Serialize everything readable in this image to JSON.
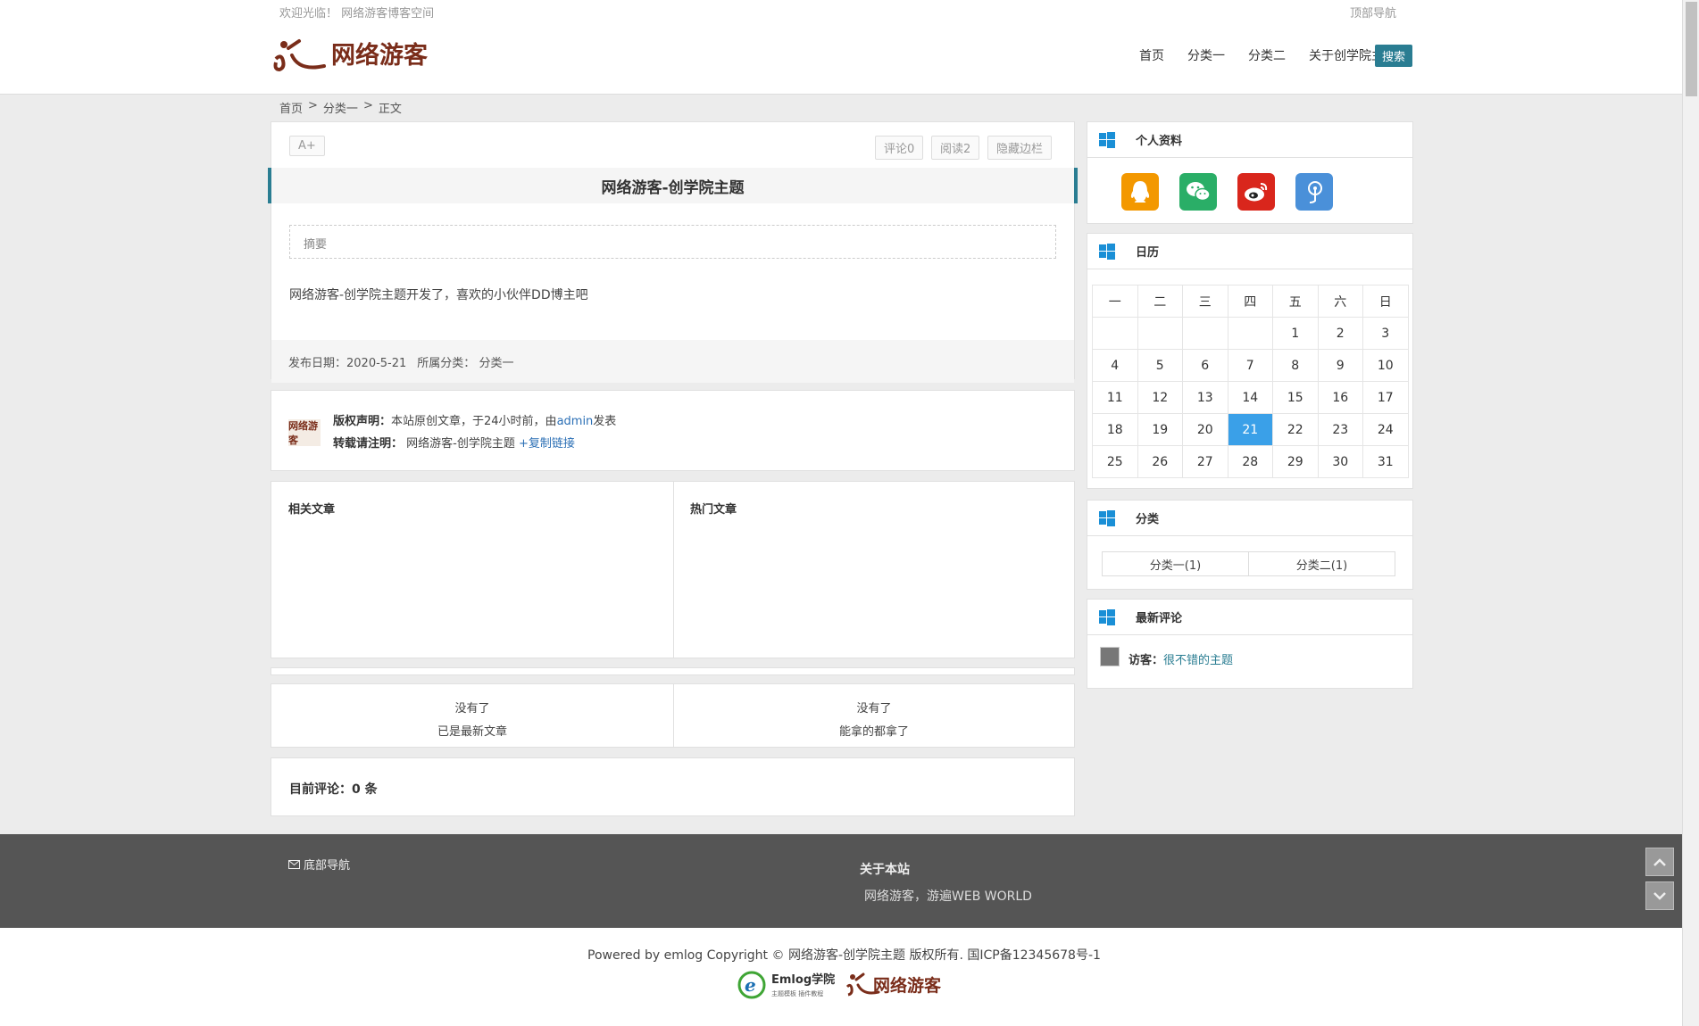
{
  "header": {
    "welcome": "欢迎光临！ 网络游客博客空间",
    "top_nav": "顶部导航",
    "logo_text": "网络游客",
    "nav": [
      "首页",
      "分类一",
      "分类二",
      "关于创学院主题"
    ],
    "search": "搜索"
  },
  "breadcrumb": [
    "首页",
    ">",
    "分类一",
    ">",
    "正文"
  ],
  "article": {
    "font_btn": "A+",
    "comments_btn": "评论0",
    "reads_btn": "阅读2",
    "hide_sidebar_btn": "隐藏边栏",
    "title": "网络游客-创学院主题",
    "summary_label": "摘要",
    "body": "网络游客-创学院主题开发了，喜欢的小伙伴DD博主吧",
    "date_label": "发布日期：2020-5-21",
    "category_label": "所属分类：",
    "category_value": "分类一"
  },
  "copyright": {
    "avatar_text": "网络游客",
    "line1_label": "版权声明：",
    "line1_text_a": "本站原创文章，于24小时前，由",
    "line1_author": "admin",
    "line1_text_b": "发表",
    "line2_label": "转载请注明：",
    "line2_text": "网络游客-创学院主题",
    "line2_link": "+复制链接"
  },
  "related": {
    "left_title": "相关文章",
    "right_title": "热门文章"
  },
  "post_nav": {
    "prev_line1": "没有了",
    "prev_line2": "已是最新文章",
    "next_line1": "没有了",
    "next_line2": "能拿的都拿了"
  },
  "comments": {
    "label": "目前评论：",
    "count": "0",
    "unit": "条"
  },
  "sidebar": {
    "profile_title": "个人资料",
    "calendar_title": "日历",
    "weekdays": [
      "一",
      "二",
      "三",
      "四",
      "五",
      "六",
      "日"
    ],
    "calendar_rows": [
      [
        "",
        "",
        "",
        "",
        "1",
        "2",
        "3"
      ],
      [
        "4",
        "5",
        "6",
        "7",
        "8",
        "9",
        "10"
      ],
      [
        "11",
        "12",
        "13",
        "14",
        "15",
        "16",
        "17"
      ],
      [
        "18",
        "19",
        "20",
        "21",
        "22",
        "23",
        "24"
      ],
      [
        "25",
        "26",
        "27",
        "28",
        "29",
        "30",
        "31"
      ]
    ],
    "today": "21",
    "category_title": "分类",
    "categories": [
      "分类一(1)",
      "分类二(1)"
    ],
    "latest_comments_title": "最新评论",
    "comment_author": "访客：",
    "comment_text": "很不错的主题"
  },
  "footer": {
    "bottom_nav": "底部导航",
    "about_title": "关于本站",
    "about_text": "网络游客，游遍WEB WORLD",
    "powered": "Powered by emlog Copyright ©  网络游客-创学院主题  版权所有. 国ICP备12345678号-1",
    "emlog_logo_text": "Emlog学院",
    "emlog_logo_sub": "主题模板  插件教程",
    "logo_text": "网络游客"
  },
  "colors": {
    "accent": "#2a7d92",
    "calendar_today": "#3aa0e8",
    "logo_brown": "#7a2d1a",
    "footer_bg": "#555555",
    "qq": "#f39800",
    "wechat": "#2aae67",
    "weibo": "#d9261c",
    "blog": "#4a90d9"
  }
}
